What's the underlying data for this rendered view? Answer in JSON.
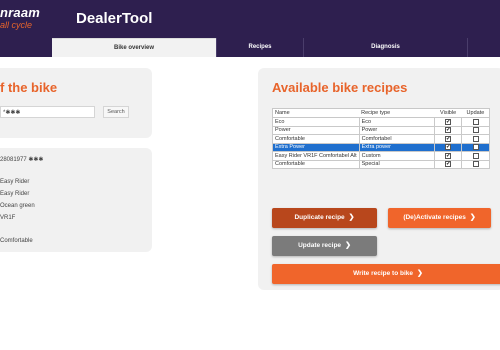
{
  "header": {
    "brand": "nraam",
    "tagline": "all cycle",
    "app_title": "DealerTool"
  },
  "tabs": [
    {
      "label": "Bike overview",
      "active": true
    },
    {
      "label": "Recipes",
      "active": false
    },
    {
      "label": "Diagnosis",
      "active": false
    }
  ],
  "left": {
    "title": "f the bike",
    "search_value": "*✱✱✱",
    "search_button": "Search",
    "info": [
      "28081977 ✱✱✱",
      "Easy Rider",
      "Easy Rider",
      "Ocean green",
      "VR1F",
      "",
      "Comfortable"
    ]
  },
  "recipes": {
    "title": "Available bike recipes",
    "columns": [
      "Name",
      "Recipe type",
      "Visible",
      "Update"
    ],
    "rows": [
      {
        "name": "Eco",
        "type": "Eco",
        "visible": true,
        "update": false,
        "selected": false
      },
      {
        "name": "Power",
        "type": "Power",
        "visible": true,
        "update": false,
        "selected": false
      },
      {
        "name": "Comfortable",
        "type": "Comfortabel",
        "visible": true,
        "update": false,
        "selected": false
      },
      {
        "name": "Extra Power",
        "type": "Extra power",
        "visible": true,
        "update": false,
        "selected": true
      },
      {
        "name": "Easy Rider VR1F Comfortabel Alt",
        "type": "Custom",
        "visible": true,
        "update": false,
        "selected": false
      },
      {
        "name": "Comfortable",
        "type": "Special",
        "visible": true,
        "update": false,
        "selected": false
      }
    ],
    "buttons": {
      "duplicate": "Duplicate recipe",
      "activate": "(De)Activate recipes",
      "update": "Update recipe",
      "write": "Write recipe to bike"
    }
  },
  "colors": {
    "header": "#2e1f4f",
    "accent": "#e8642b",
    "button_primary": "#f0652b",
    "button_dark": "#b8471c",
    "button_disabled": "#7b7b7b",
    "selection": "#1f6fce"
  }
}
